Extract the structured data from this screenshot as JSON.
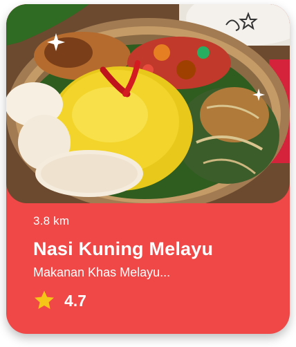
{
  "card": {
    "distance": "3.8 km",
    "title": "Nasi Kuning Melayu",
    "subtitle": "Makanan Khas Melayu...",
    "rating": "4.7",
    "image_alt": "Nasi Kuning Melayu dish photo",
    "icons": {
      "rating": "star-icon",
      "decoration": "sparkle-icon"
    }
  },
  "colors": {
    "card_background": "#f04747",
    "star": "#f5c518",
    "text": "#ffffff"
  }
}
